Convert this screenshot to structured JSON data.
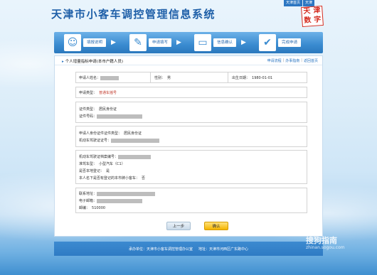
{
  "header": {
    "site_title": "天津市小客车调控管理信息系统",
    "top_links": [
      "天津首页",
      "天津"
    ],
    "logo_chars": [
      "天",
      "津",
      "数",
      "字"
    ]
  },
  "steps": [
    {
      "icon": "person-icon",
      "glyph": "☺",
      "label": "填报说明"
    },
    {
      "icon": "edit-icon",
      "glyph": "✎",
      "label": "申请填写"
    },
    {
      "icon": "display-icon",
      "glyph": "▭",
      "label": "信息确认"
    },
    {
      "icon": "check-icon",
      "glyph": "✔",
      "label": "完成申请"
    }
  ],
  "panel": {
    "title": "个人增量指标申请(本市户籍人员)",
    "links": [
      "申请流程",
      "办事指南",
      "返回首页"
    ]
  },
  "form": {
    "applicant_name_label": "申请人姓名：",
    "gender_label": "性别：",
    "gender_value": "男",
    "birth_label": "出生日期：",
    "birth_value": "1980-01-01",
    "apply_type_label": "申请类型：",
    "apply_type_value": "普通车摇号",
    "id_type_label": "证件类型：",
    "id_type_value": "居民身份证",
    "id_number_label": "证件号码：",
    "proxy_id_type_label": "申请人身份证件证件类型：",
    "proxy_id_type_value": "居民身份证",
    "proxy_id_number_label": "机动车驾驶证证号：",
    "license_number_label": "机动车驾驶证档案编号：",
    "license_type_label": "准驾车型：",
    "license_type_value": "小型汽车（C1）",
    "local_reg_label": "是否本地登记：",
    "local_reg_value": "是",
    "has_vehicle_label": "本人名下是否有登记的本市牌小客车：",
    "has_vehicle_value": "否",
    "contact_address_label": "联系地址：",
    "email_label": "电子邮箱：",
    "postcode_label": "邮编：",
    "postcode_value": "510000"
  },
  "buttons": {
    "prev_label": "上一步",
    "confirm_label": "确认"
  },
  "footer": {
    "host": "承办单位：天津市小客车调控管理办公室",
    "address": "地址：天津市河西区广东路中心"
  },
  "watermark": {
    "main": "搜狗指南",
    "sub": "zhinan.sogou.com"
  },
  "colors": {
    "brand_blue": "#1e5fa8",
    "accent_red": "#c0392b",
    "confirm_yellow": "#f4b400"
  }
}
